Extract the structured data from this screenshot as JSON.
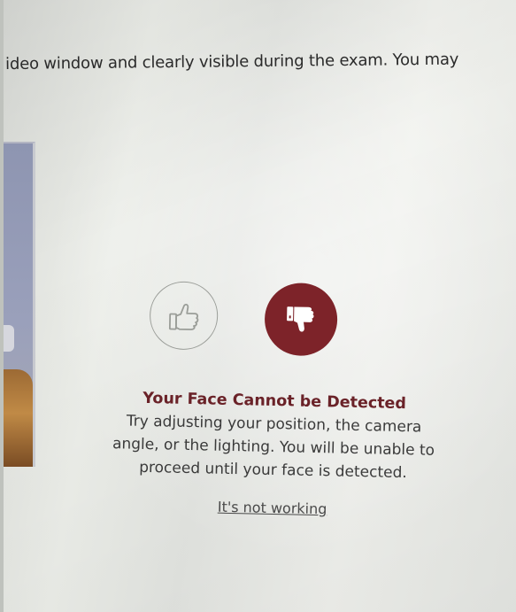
{
  "instructions": {
    "text": "ideo window and clearly visible during the exam. You may"
  },
  "video_preview": {
    "label": ""
  },
  "face_check": {
    "pass_icon": "thumbs-up-icon",
    "fail_icon": "thumbs-down-icon",
    "selected": "fail",
    "title": "Your Face Cannot be Detected",
    "message": "Try adjusting your position, the camera angle, or the lighting. You will be unable to proceed until your face is detected.",
    "help_link": "It's not working"
  },
  "colors": {
    "accent": "#7d2329",
    "title": "#6a2228",
    "body_text": "#3a3a3a",
    "inactive_icon": "#9a9d98"
  }
}
